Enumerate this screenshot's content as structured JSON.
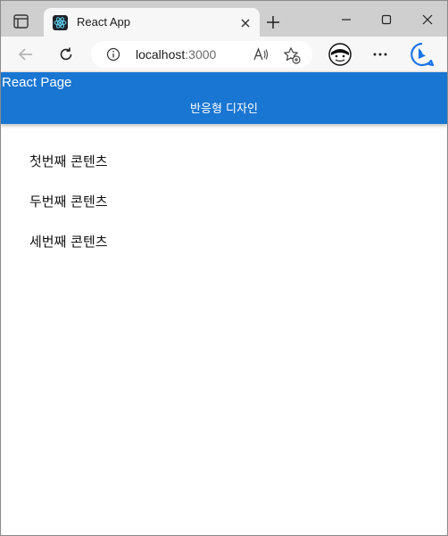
{
  "browser": {
    "tab": {
      "title": "React App"
    },
    "address": {
      "host": "localhost",
      "port": ":3000"
    }
  },
  "app": {
    "header": {
      "title": "React Page",
      "subtitle": "반응형 디자인"
    },
    "contents": [
      "첫번째 콘텐츠",
      "두번째 콘텐츠",
      "세번째 콘텐츠"
    ]
  },
  "colors": {
    "header_bg": "#1976d2",
    "titlebar_bg": "#cfcfcf",
    "toolbar_bg": "#f7f7f7"
  }
}
